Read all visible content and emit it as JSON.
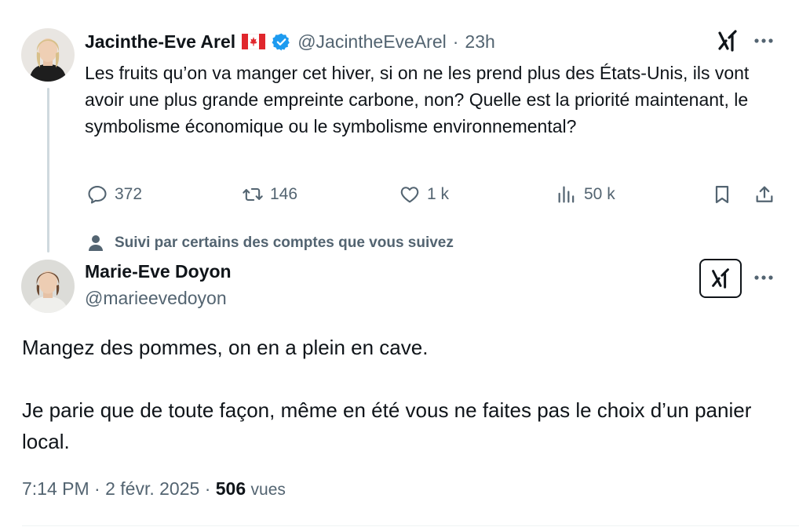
{
  "tweet1": {
    "author_name": "Jacinthe-Eve Arel",
    "handle": "@JacintheEveArel",
    "separator": "·",
    "time_ago": "23h",
    "text": "Les fruits qu’on va manger cet hiver, si on ne les prend plus des États-Unis, ils vont avoir une plus grande empreinte carbone, non? Quelle est la priorité maintenant, le symbolisme économique ou le symbolisme environnemental?",
    "actions": {
      "replies": "372",
      "reposts": "146",
      "likes": "1 k",
      "views": "50 k"
    },
    "flag_icon": "canada-flag-icon",
    "verified_icon": "verified-badge-icon",
    "accent_color": "#1d9bf0"
  },
  "social_context": {
    "icon": "person-icon",
    "text": "Suivi par certains des comptes que vous suivez"
  },
  "tweet2": {
    "author_name": "Marie-Eve Doyon",
    "handle": "@marieevedoyon",
    "text_lines": [
      "Mangez des pommes, on en a plein en cave.",
      "",
      "Je parie que de toute façon, même en été vous ne faites pas le choix d’un panier local."
    ],
    "time": "7:14 PM",
    "date": "2 févr. 2025",
    "views_count": "506",
    "views_label": "vues",
    "meta_separator": "·"
  }
}
